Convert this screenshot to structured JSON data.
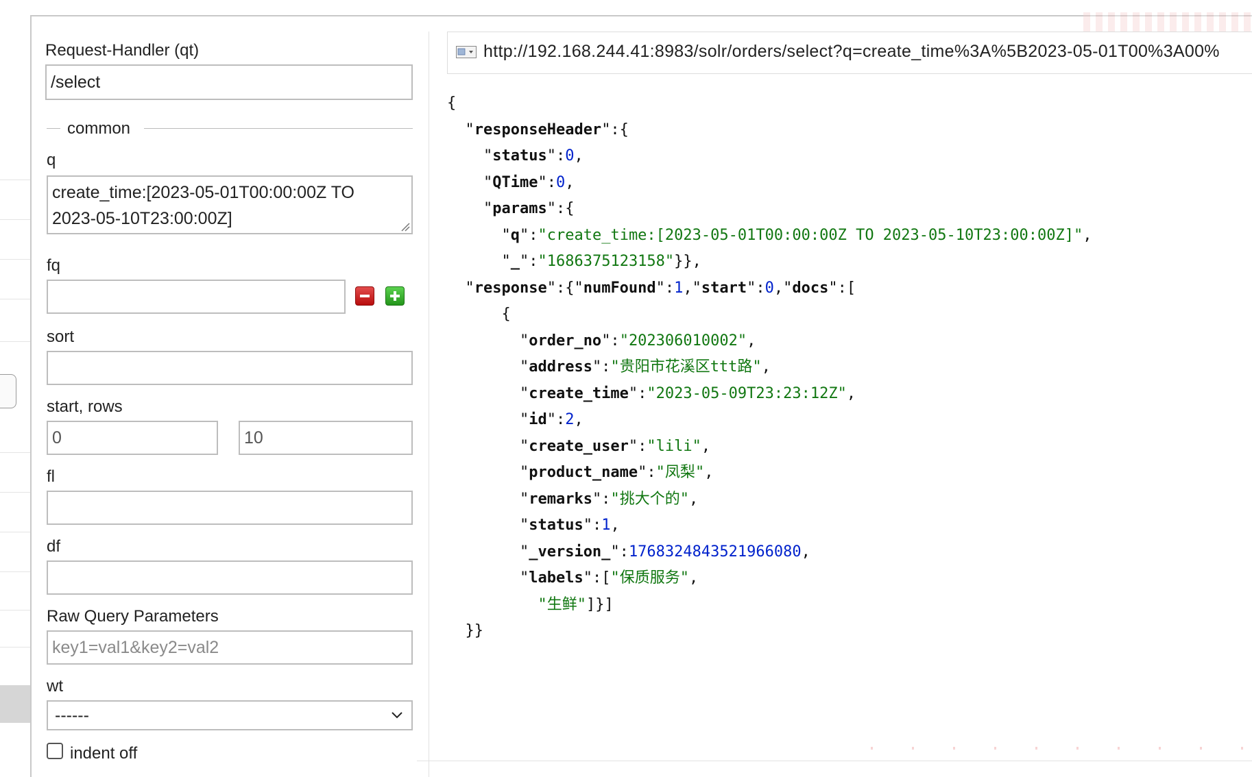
{
  "form": {
    "request_handler": {
      "label": "Request-Handler (qt)",
      "value": "/select"
    },
    "common_legend": "common",
    "q": {
      "label": "q",
      "value_line1": "create_time:[2023-05-01T00:00:00Z TO",
      "value_line2": "2023-05-10T23:00:00Z]"
    },
    "fq": {
      "label": "fq",
      "value": ""
    },
    "sort": {
      "label": "sort",
      "value": ""
    },
    "start_rows": {
      "label": "start, rows",
      "start_value": "0",
      "rows_value": "10"
    },
    "fl": {
      "label": "fl",
      "value": ""
    },
    "df": {
      "label": "df",
      "value": ""
    },
    "raw_query": {
      "label": "Raw Query Parameters",
      "placeholder": "key1=val1&key2=val2"
    },
    "wt": {
      "label": "wt",
      "selected": "------"
    },
    "indent": {
      "label": "indent off",
      "checked": false
    }
  },
  "result": {
    "url": "http://192.168.244.41:8983/solr/orders/select?q=create_time%3A%5B2023-05-01T00%3A00%",
    "json": {
      "responseHeader": {
        "status": "0",
        "QTime": "0",
        "params": {
          "q": "create_time:[2023-05-01T00:00:00Z TO 2023-05-10T23:00:00Z]",
          "_": "1686375123158"
        }
      },
      "response": {
        "numFound": "1",
        "start": "0",
        "doc": {
          "order_no": "202306010002",
          "address": "贵阳市花溪区ttt路",
          "create_time": "2023-05-09T23:23:12Z",
          "id": "2",
          "create_user": "lili",
          "product_name": "凤梨",
          "remarks": "挑大个的",
          "status": "1",
          "_version_": "1768324843521966080",
          "labels": [
            "保质服务",
            "生鲜"
          ]
        }
      }
    }
  },
  "colors": {
    "json_string": "#117711",
    "json_number": "#0022cc",
    "remove_button": "#c81f1f",
    "add_button": "#2fa52a"
  },
  "icons": {
    "fq_remove": "minus-icon",
    "fq_add": "plus-icon",
    "url_bar": "page-icon",
    "wt_dropdown": "chevron-down-icon"
  }
}
